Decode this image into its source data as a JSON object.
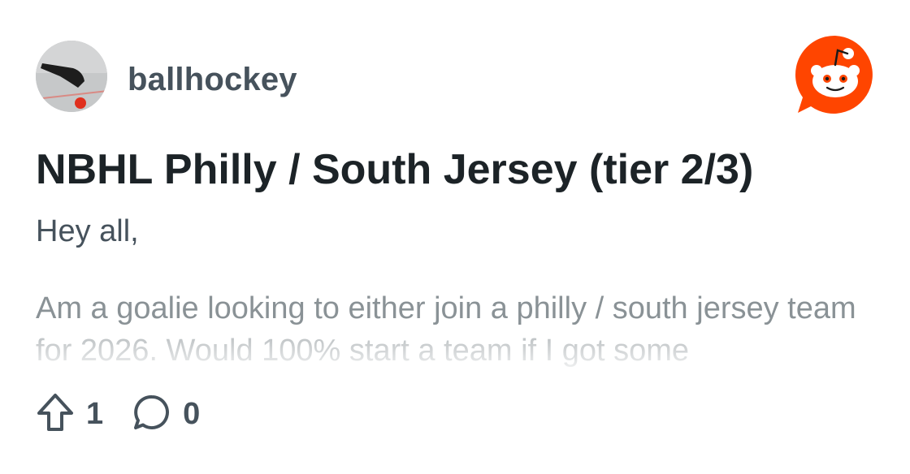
{
  "post": {
    "username": "ballhockey",
    "title": "NBHL Philly / South Jersey (tier 2/3)",
    "greeting": "Hey all,",
    "excerpt": "Am a goalie looking to either join a philly / south jersey team for 2026. Would 100% start a team if I got some",
    "upvotes": "1",
    "comments": "0"
  },
  "icons": {
    "upvote": "upvote-arrow-icon",
    "comment": "comment-bubble-icon",
    "logo": "reddit-snoo-logo"
  },
  "colors": {
    "brand": "#ff4500",
    "text_primary": "#1c2327",
    "text_secondary": "#46525c",
    "text_muted": "#8a9296"
  }
}
